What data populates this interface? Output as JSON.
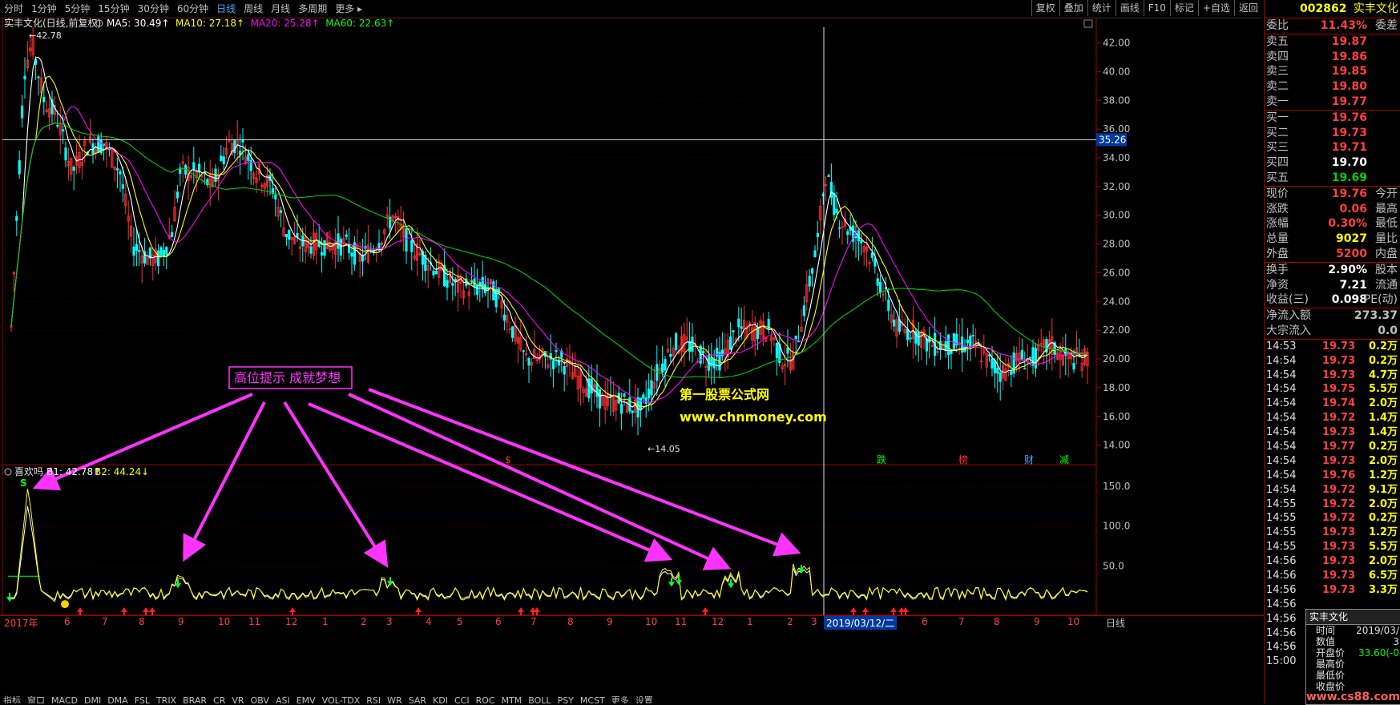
{
  "topbar": {
    "tabs": [
      "分时",
      "1分钟",
      "5分钟",
      "15分钟",
      "30分钟",
      "60分钟",
      "日线",
      "周线",
      "月线",
      "多周期",
      "更多"
    ],
    "active_tab": "日线",
    "right_tools": [
      "复权",
      "叠加",
      "统计",
      "画线",
      "F10",
      "标记",
      "+自选",
      "返回"
    ]
  },
  "main_chart": {
    "legend_title": "实丰文化(日线,前复权)",
    "ma": [
      {
        "label": "MA5: 30.49",
        "color": "#ffffff"
      },
      {
        "label": "MA10: 27.18",
        "color": "#ffff00"
      },
      {
        "label": "MA20: 25.28",
        "color": "#ff00ff"
      },
      {
        "label": "MA60: 22.63",
        "color": "#00ff00"
      }
    ],
    "high_label": "42.78",
    "low_label": "14.05",
    "price_axis": [
      "42.00",
      "40.00",
      "38.00",
      "36.00",
      "34.00",
      "32.00",
      "30.00",
      "28.00",
      "26.00",
      "24.00",
      "22.00",
      "20.00",
      "18.00",
      "16.00",
      "14.00"
    ],
    "cursor_price": "35.26",
    "promo_line1": "第一股票公式网",
    "promo_line2": "www.chnmoney.com",
    "annotation_box": "高位提示  成就梦想",
    "event_tags": [
      "跌",
      "榜",
      "财",
      "减"
    ],
    "event_marker": "$"
  },
  "indicator": {
    "title": "喜欢吗",
    "b1": "B1: 42.78",
    "b2": "B2: 44.24",
    "axis": [
      "150.0",
      "100.0",
      "50.0"
    ],
    "s_marker": "S"
  },
  "date_axis": {
    "year_label": "2017年",
    "months": [
      "6",
      "7",
      "8",
      "9",
      "10",
      "11",
      "12",
      "1",
      "2",
      "3",
      "4",
      "5",
      "6",
      "7",
      "8",
      "9",
      "10",
      "11",
      "12",
      "1",
      "2",
      "3",
      "5",
      "6",
      "7",
      "8",
      "9",
      "10"
    ],
    "cursor_date": "2019/03/12/二",
    "right_label": "日线"
  },
  "bottom_tabs": [
    "指标",
    "窗口",
    "MACD",
    "DMI",
    "DMA",
    "FSL",
    "TRIX",
    "BRAR",
    "CR",
    "VR",
    "OBV",
    "ASI",
    "EMV",
    "VOL-TDX",
    "RSI",
    "WR",
    "SAR",
    "KDJ",
    "CCI",
    "ROC",
    "MTM",
    "BOLL",
    "PSY",
    "MCST",
    "更多",
    "设置"
  ],
  "quote": {
    "code": "002862",
    "name": "实丰文化",
    "webi_label": "委比",
    "webi_value": "11.43%",
    "weicha_label": "委差",
    "sells": [
      {
        "label": "卖五",
        "price": "19.87"
      },
      {
        "label": "卖四",
        "price": "19.86"
      },
      {
        "label": "卖三",
        "price": "19.85"
      },
      {
        "label": "卖二",
        "price": "19.80"
      },
      {
        "label": "卖一",
        "price": "19.77"
      }
    ],
    "buys": [
      {
        "label": "买一",
        "price": "19.76",
        "cls": "red"
      },
      {
        "label": "买二",
        "price": "19.73",
        "cls": "red"
      },
      {
        "label": "买三",
        "price": "19.71",
        "cls": "red"
      },
      {
        "label": "买四",
        "price": "19.70",
        "cls": "wht"
      },
      {
        "label": "买五",
        "price": "19.69",
        "cls": "grn"
      }
    ],
    "stats": [
      {
        "l": "现价",
        "m": "19.76",
        "r": "今开",
        "cls": "red"
      },
      {
        "l": "涨跌",
        "m": "0.06",
        "r": "最高",
        "cls": "red"
      },
      {
        "l": "涨幅",
        "m": "0.30%",
        "r": "最低",
        "cls": "red"
      },
      {
        "l": "总量",
        "m": "9027",
        "r": "量比",
        "cls": "yel"
      },
      {
        "l": "外盘",
        "m": "5200",
        "r": "内盘",
        "cls": "red"
      }
    ],
    "stats2": [
      {
        "l": "换手",
        "m": "2.90%",
        "r": "股本",
        "cls": "wht"
      },
      {
        "l": "净资",
        "m": "7.21",
        "r": "流通",
        "cls": "wht"
      },
      {
        "l": "收益(三)",
        "m": "0.098",
        "r": "PE(动)",
        "cls": "wht"
      }
    ],
    "flow": [
      {
        "l": "净流入额",
        "v": "273.37",
        "cls": "red"
      },
      {
        "l": "大宗流入",
        "v": "0.0",
        "cls": "wht"
      }
    ],
    "ticks": [
      {
        "t": "14:53",
        "p": "19.73",
        "v": "0.2万",
        "cls": "red"
      },
      {
        "t": "14:54",
        "p": "19.73",
        "v": "0.2万",
        "cls": "red"
      },
      {
        "t": "14:54",
        "p": "19.73",
        "v": "4.7万",
        "cls": "red"
      },
      {
        "t": "14:54",
        "p": "19.75",
        "v": "5.5万",
        "cls": "red"
      },
      {
        "t": "14:54",
        "p": "19.74",
        "v": "2.0万",
        "cls": "red"
      },
      {
        "t": "14:54",
        "p": "19.72",
        "v": "1.4万",
        "cls": "red"
      },
      {
        "t": "14:54",
        "p": "19.73",
        "v": "1.4万",
        "cls": "red"
      },
      {
        "t": "14:54",
        "p": "19.77",
        "v": "0.2万",
        "cls": "red"
      },
      {
        "t": "14:54",
        "p": "19.73",
        "v": "2.0万",
        "cls": "red"
      },
      {
        "t": "14:54",
        "p": "19.76",
        "v": "1.2万",
        "cls": "red"
      },
      {
        "t": "14:54",
        "p": "19.72",
        "v": "9.1万",
        "cls": "red"
      },
      {
        "t": "14:55",
        "p": "19.72",
        "v": "2.0万",
        "cls": "red"
      },
      {
        "t": "14:55",
        "p": "19.72",
        "v": "0.2万",
        "cls": "red"
      },
      {
        "t": "14:55",
        "p": "19.73",
        "v": "1.2万",
        "cls": "red"
      },
      {
        "t": "14:55",
        "p": "19.73",
        "v": "5.5万",
        "cls": "red"
      },
      {
        "t": "14:56",
        "p": "19.73",
        "v": "2.0万",
        "cls": "red"
      },
      {
        "t": "14:56",
        "p": "19.73",
        "v": "6.5万",
        "cls": "red"
      },
      {
        "t": "14:56",
        "p": "19.73",
        "v": "3.3万",
        "cls": "red"
      },
      {
        "t": "14:56",
        "p": "",
        "v": "",
        "cls": "red"
      },
      {
        "t": "14:56",
        "p": "",
        "v": "",
        "cls": "red"
      },
      {
        "t": "14:56",
        "p": "",
        "v": "",
        "cls": "red"
      },
      {
        "t": "14:56",
        "p": "",
        "v": "",
        "cls": "red"
      },
      {
        "t": "15:00",
        "p": "",
        "v": "",
        "cls": "red"
      }
    ],
    "popup": {
      "title": "实丰文化",
      "rows": [
        {
          "a": "时间",
          "b": "2019/03/"
        },
        {
          "a": "数值",
          "b": "3"
        },
        {
          "a": "开盘价",
          "b": "33.60(-0"
        },
        {
          "a": "最高价",
          "b": ""
        },
        {
          "a": "最低价",
          "b": ""
        },
        {
          "a": "收盘价",
          "b": ""
        }
      ]
    },
    "watermark": "www.cs88.com"
  }
}
